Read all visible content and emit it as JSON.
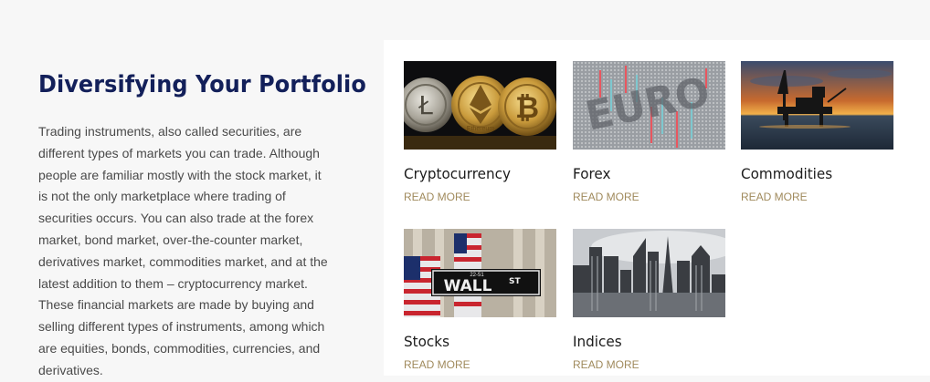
{
  "section": {
    "title": "Diversifying Your Portfolio",
    "description": "Trading instruments, also called securities, are different types of markets you can trade. Although people are familiar mostly with the stock market, it is not the only marketplace where trading of securities occurs. You can also trade at the forex market, bond market, over-the-counter market, derivatives market, commodities market, and at the latest addition to them – cryptocurrency market. These financial markets are made by buying and selling different types of instruments, among which are equities, bonds, commodities, currencies, and derivatives."
  },
  "cards": [
    {
      "name": "Cryptocurrency",
      "link": "READ MORE",
      "image_text": "Ethereum"
    },
    {
      "name": "Forex",
      "link": "READ MORE",
      "image_text": "EURO"
    },
    {
      "name": "Commodities",
      "link": "READ MORE"
    },
    {
      "name": "Stocks",
      "link": "READ MORE",
      "image_text": "WALL",
      "image_text_sub": "ST",
      "image_text_small": "22-51"
    },
    {
      "name": "Indices",
      "link": "READ MORE"
    }
  ],
  "colors": {
    "title": "#13205a",
    "link": "#a08a5c",
    "panel_bg": "#f7f7f7",
    "cards_bg": "#ffffff"
  }
}
